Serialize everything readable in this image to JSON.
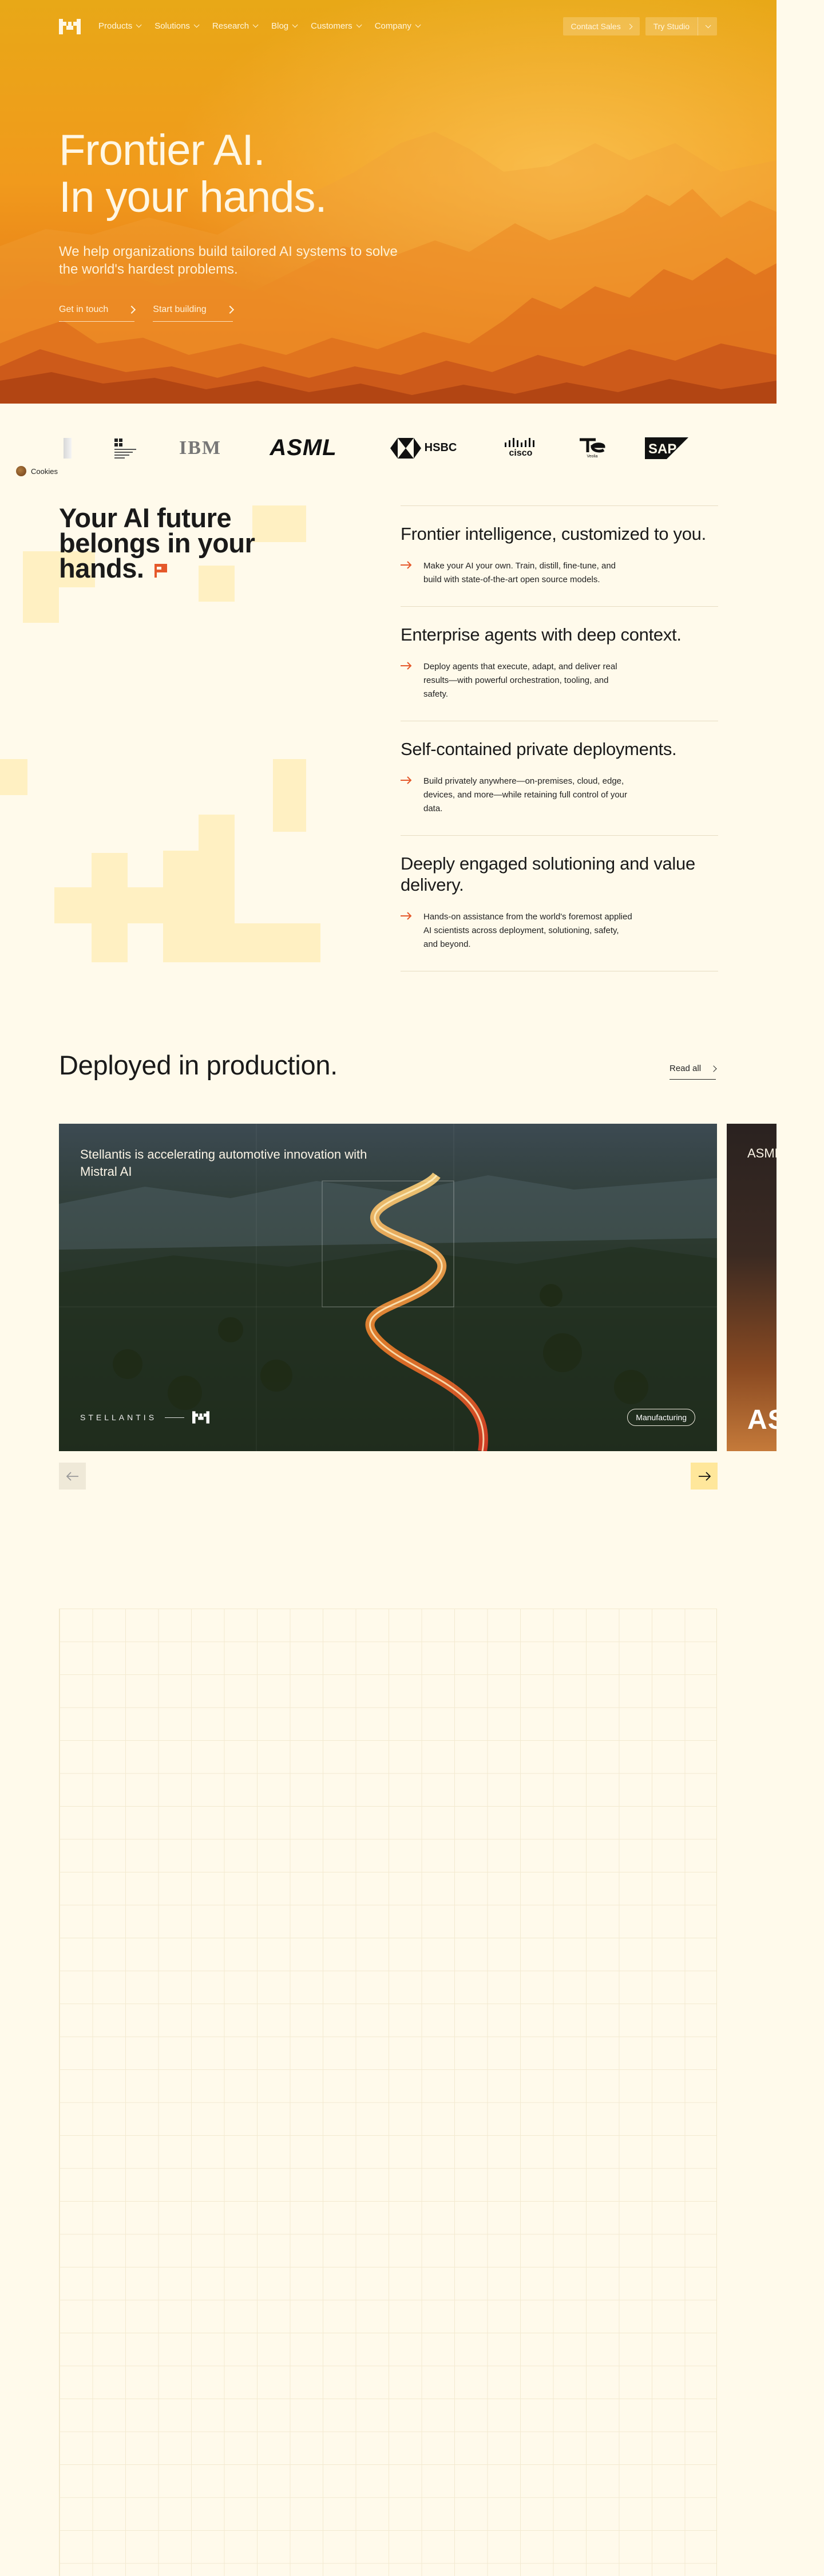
{
  "nav": {
    "links": [
      "Products",
      "Solutions",
      "Research",
      "Blog",
      "Customers",
      "Company"
    ],
    "contact_sales": "Contact Sales",
    "try_studio": "Try Studio"
  },
  "hero": {
    "title_line1": "Frontier AI.",
    "title_line2": "In your hands.",
    "subtitle": "We help organizations build tailored AI systems to solve the world's hardest problems.",
    "cta_primary": "Get in touch",
    "cta_secondary": "Start building"
  },
  "logos": {
    "ibm": "IBM",
    "asml": "ASML",
    "hsbc": "HSBC",
    "cisco": "cisco",
    "sap": "SAP",
    "veolia_small": "Veolia"
  },
  "cookies": {
    "label": "Cookies"
  },
  "future": {
    "title": "Your AI future belongs in your hands.",
    "features": [
      {
        "title": "Frontier intelligence, customized to you.",
        "body": "Make your AI your own. Train, distill, fine-tune, and build with state-of-the-art open source models."
      },
      {
        "title": "Enterprise agents with deep context.",
        "body": "Deploy agents that execute, adapt, and deliver real results—with powerful orchestration, tooling, and safety."
      },
      {
        "title": "Self-contained private deployments.",
        "body": "Build privately anywhere—on-premises, cloud, edge, devices, and more—while retaining full control of your data."
      },
      {
        "title": "Deeply engaged solutioning and value delivery.",
        "body": "Hands-on assistance from the world's foremost applied AI scientists across deployment, solutioning, safety, and beyond."
      }
    ]
  },
  "deployed": {
    "title": "Deployed in production.",
    "read_all": "Read all",
    "cards": [
      {
        "title": "Stellantis is accelerating automotive innovation with Mistral AI",
        "brand": "STELLANTIS",
        "tag": "Manufacturing"
      },
      {
        "title": "ASML",
        "brand": "ASML"
      }
    ]
  },
  "colors": {
    "background": "#FFFAEB",
    "hero_orange": "#F08A1A",
    "accent_arrow": "#E5582A",
    "pixel_block": "#FFF0C2",
    "next_button": "#FFE79B"
  }
}
